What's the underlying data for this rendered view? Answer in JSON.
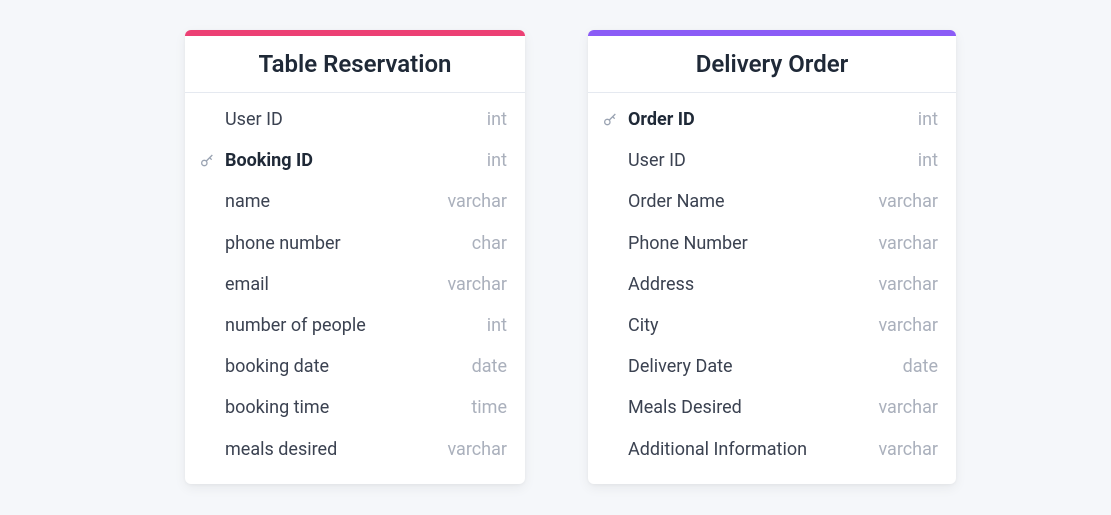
{
  "entities": [
    {
      "title": "Table Reservation",
      "accent": "#ec4074",
      "columns": [
        {
          "name": "User ID",
          "type": "int",
          "pk": false
        },
        {
          "name": "Booking ID",
          "type": "int",
          "pk": true
        },
        {
          "name": "name",
          "type": "varchar",
          "pk": false
        },
        {
          "name": "phone number",
          "type": "char",
          "pk": false
        },
        {
          "name": "email",
          "type": "varchar",
          "pk": false
        },
        {
          "name": "number of people",
          "type": "int",
          "pk": false
        },
        {
          "name": "booking date",
          "type": "date",
          "pk": false
        },
        {
          "name": "booking time",
          "type": "time",
          "pk": false
        },
        {
          "name": "meals desired",
          "type": "varchar",
          "pk": false
        }
      ]
    },
    {
      "title": "Delivery Order",
      "accent": "#8b5cf6",
      "columns": [
        {
          "name": "Order ID",
          "type": "int",
          "pk": true
        },
        {
          "name": "User ID",
          "type": "int",
          "pk": false
        },
        {
          "name": "Order Name",
          "type": "varchar",
          "pk": false
        },
        {
          "name": "Phone Number",
          "type": "varchar",
          "pk": false
        },
        {
          "name": "Address",
          "type": "varchar",
          "pk": false
        },
        {
          "name": "City",
          "type": "varchar",
          "pk": false
        },
        {
          "name": "Delivery Date",
          "type": "date",
          "pk": false
        },
        {
          "name": "Meals Desired",
          "type": "varchar",
          "pk": false
        },
        {
          "name": "Additional Information",
          "type": "varchar",
          "pk": false
        }
      ]
    }
  ]
}
